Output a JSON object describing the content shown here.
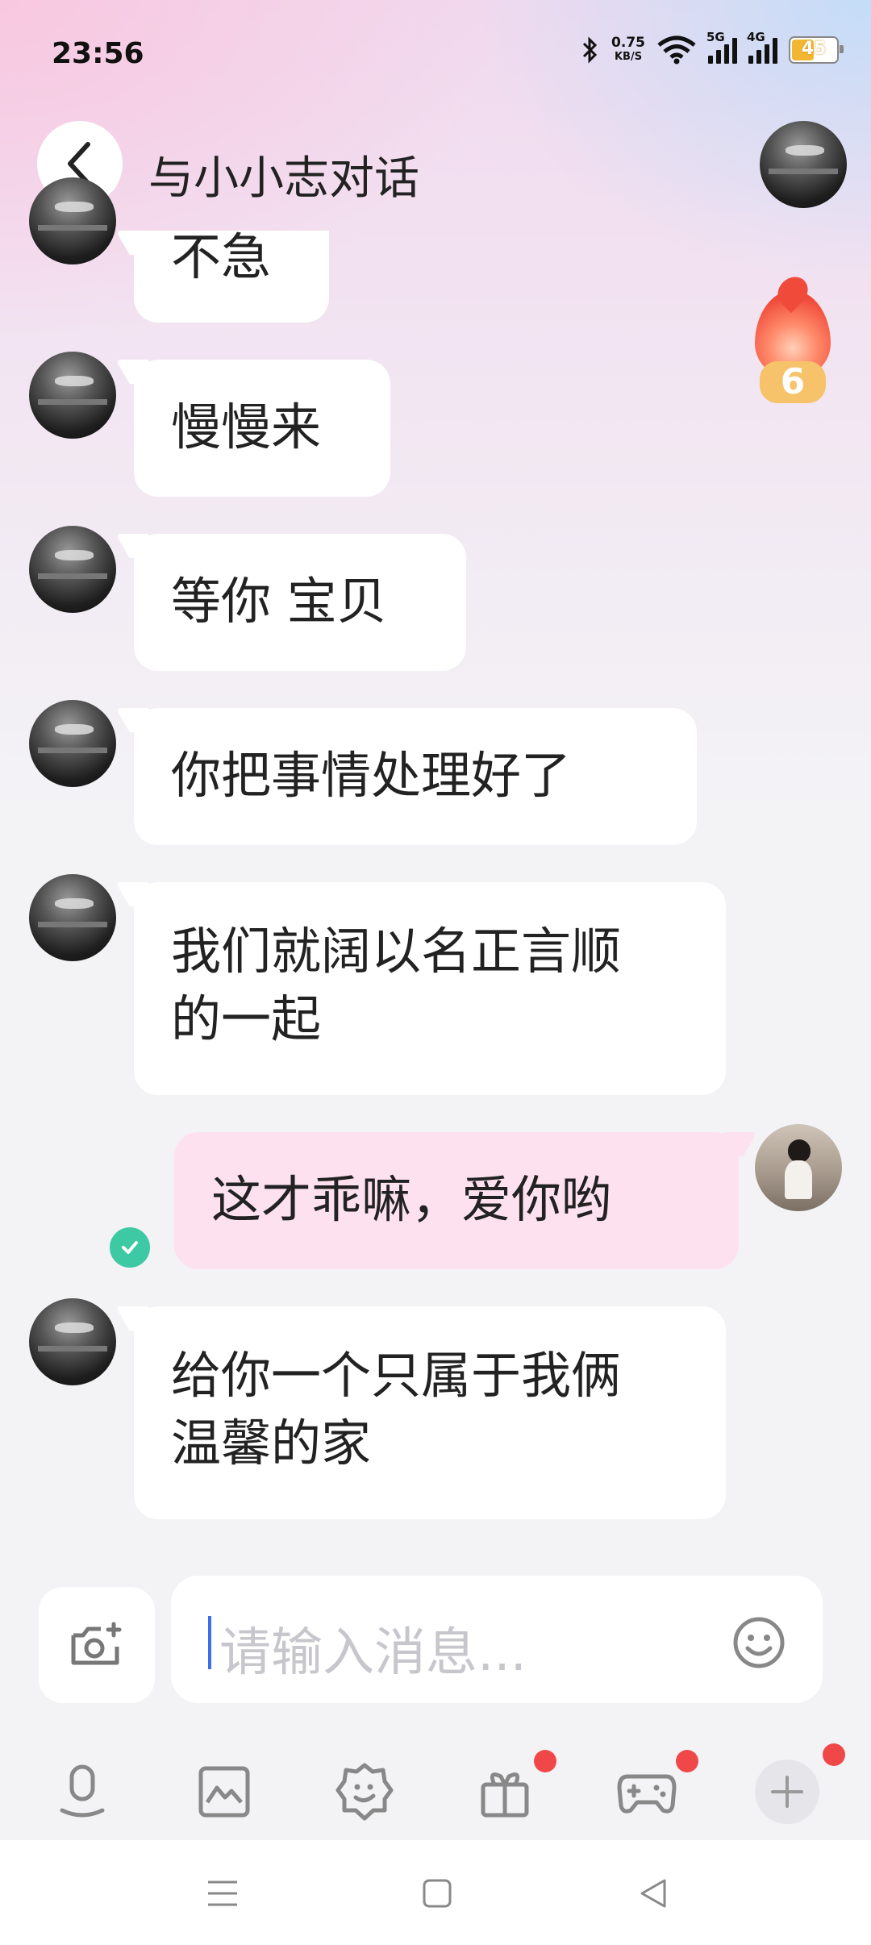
{
  "status_bar": {
    "time": "23:56",
    "net_speed_value": "0.75",
    "net_speed_unit": "KB/S",
    "signal_5g": "5G",
    "signal_4g": "4G",
    "battery": "45",
    "icons": [
      "bluetooth-icon",
      "wifi-icon",
      "signal-icon",
      "battery-icon"
    ]
  },
  "header": {
    "title": "与小小志对话"
  },
  "streak": {
    "count": "6",
    "color": "#f04a3a"
  },
  "messages": [
    {
      "side": "received",
      "text": "不急"
    },
    {
      "side": "received",
      "text": "慢慢来"
    },
    {
      "side": "received",
      "text": "等你 宝贝"
    },
    {
      "side": "received",
      "text": "你把事情处理好了"
    },
    {
      "side": "received",
      "text": "我们就阔以名正言顺的一起"
    },
    {
      "side": "sent",
      "text": "这才乖嘛，爱你哟"
    },
    {
      "side": "received",
      "text": "给你一个只属于我俩温馨的家"
    }
  ],
  "composer": {
    "placeholder": "请输入消息..."
  },
  "toolbar": {
    "items": [
      "voice-icon",
      "image-icon",
      "sticker-icon",
      "gift-icon",
      "game-icon",
      "plus-icon"
    ]
  },
  "colors": {
    "accent_sent_bubble": "#fde1ef",
    "read_check": "#3dc9a3",
    "badge_red": "#f04848",
    "caret_blue": "#3a6fe8"
  }
}
